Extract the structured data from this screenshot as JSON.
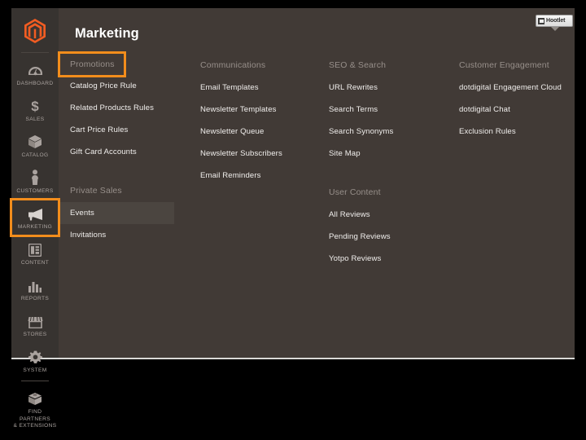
{
  "colors": {
    "accent": "#f28d1c",
    "sidebar_bg": "#373330",
    "main_bg": "#413a36",
    "heading_text": "#978f8a",
    "item_text": "#f0eeec",
    "logo_orange": "#f15c22",
    "active_row": "#4b4540"
  },
  "header": {
    "title": "Marketing"
  },
  "extension": {
    "label": "Hootlet",
    "icon": "hootlet-icon"
  },
  "sidebar": {
    "logo_icon": "magento-logo-icon",
    "items": [
      {
        "label": "DASHBOARD",
        "icon": "dashboard-icon",
        "highlighted": false
      },
      {
        "label": "SALES",
        "icon": "dollar-icon",
        "highlighted": false
      },
      {
        "label": "CATALOG",
        "icon": "box-icon",
        "highlighted": false
      },
      {
        "label": "CUSTOMERS",
        "icon": "person-icon",
        "highlighted": false
      },
      {
        "label": "MARKETING",
        "icon": "megaphone-icon",
        "highlighted": true
      },
      {
        "label": "CONTENT",
        "icon": "layout-icon",
        "highlighted": false
      },
      {
        "label": "REPORTS",
        "icon": "bar-chart-icon",
        "highlighted": false
      },
      {
        "label": "STORES",
        "icon": "storefront-icon",
        "highlighted": false
      },
      {
        "label": "SYSTEM",
        "icon": "gear-icon",
        "highlighted": false
      },
      {
        "label": "FIND PARTNERS\n& EXTENSIONS",
        "label_line1": "FIND PARTNERS",
        "label_line2": "& EXTENSIONS",
        "icon": "extension-box-icon",
        "highlighted": false
      }
    ]
  },
  "menu": {
    "columns": [
      {
        "groups": [
          {
            "title": "Promotions",
            "boxed": true,
            "items": [
              {
                "label": "Catalog Price Rule",
                "active": false
              },
              {
                "label": "Related Products Rules",
                "active": false
              },
              {
                "label": "Cart Price Rules",
                "active": false
              },
              {
                "label": "Gift Card Accounts",
                "active": false
              }
            ]
          },
          {
            "title": "Private Sales",
            "boxed": false,
            "items": [
              {
                "label": "Events",
                "active": true
              },
              {
                "label": "Invitations",
                "active": false
              }
            ]
          }
        ]
      },
      {
        "groups": [
          {
            "title": "Communications",
            "boxed": false,
            "items": [
              {
                "label": "Email Templates",
                "active": false
              },
              {
                "label": "Newsletter Templates",
                "active": false
              },
              {
                "label": "Newsletter Queue",
                "active": false
              },
              {
                "label": "Newsletter Subscribers",
                "active": false
              },
              {
                "label": "Email Reminders",
                "active": false
              }
            ]
          }
        ]
      },
      {
        "groups": [
          {
            "title": "SEO & Search",
            "boxed": false,
            "items": [
              {
                "label": "URL Rewrites",
                "active": false
              },
              {
                "label": "Search Terms",
                "active": false
              },
              {
                "label": "Search Synonyms",
                "active": false
              },
              {
                "label": "Site Map",
                "active": false
              }
            ]
          },
          {
            "title": "User Content",
            "boxed": false,
            "items": [
              {
                "label": "All Reviews",
                "active": false
              },
              {
                "label": "Pending Reviews",
                "active": false
              },
              {
                "label": "Yotpo Reviews",
                "active": false
              }
            ]
          }
        ]
      },
      {
        "groups": [
          {
            "title": "Customer Engagement",
            "boxed": false,
            "items": [
              {
                "label": "dotdigital Engagement Cloud",
                "active": false
              },
              {
                "label": "dotdigital Chat",
                "active": false
              },
              {
                "label": "Exclusion Rules",
                "active": false
              }
            ]
          }
        ]
      }
    ]
  }
}
